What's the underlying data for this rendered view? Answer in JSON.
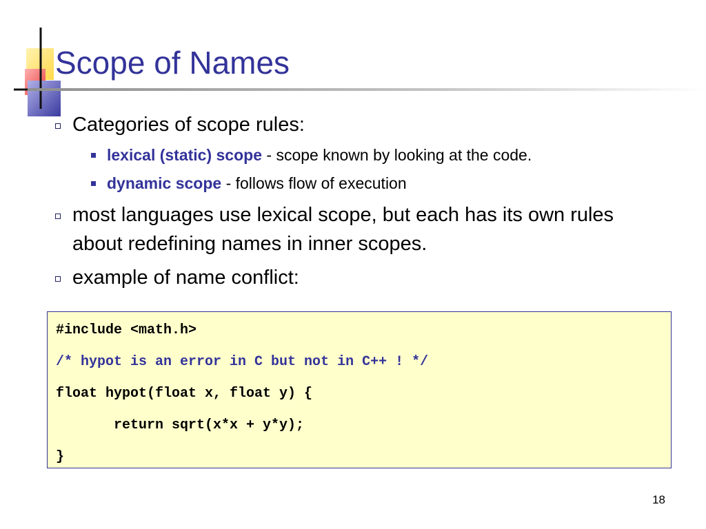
{
  "slide": {
    "title": "Scope of Names",
    "page_number": "18"
  },
  "colors": {
    "accent": "#33339a",
    "code_background": "#ffffcc",
    "deco_yellow": "#ffe66a",
    "deco_red": "#f05656",
    "deco_blue": "#4a4aa8"
  },
  "bullets": [
    {
      "text": "Categories of scope rules:"
    },
    {
      "text": "most languages use lexical scope, but each has its own rules about redefining names in inner scopes."
    },
    {
      "text": "example of name conflict:"
    }
  ],
  "sub_bullets": [
    {
      "term": "lexical (static) scope",
      "desc": " - scope known by looking at the code."
    },
    {
      "term": "dynamic scope",
      "desc": " - follows flow of execution"
    }
  ],
  "code": [
    "#include <math.h>",
    "/* hypot is an error in C but not in C++ ! */",
    "float hypot(float x, float y) {",
    "       return sqrt(x*x + y*y);",
    "}"
  ]
}
